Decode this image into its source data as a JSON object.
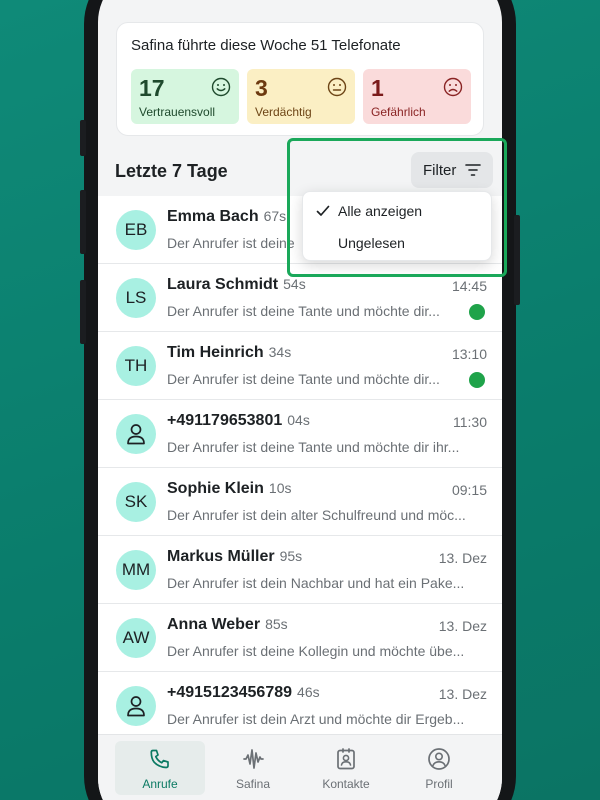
{
  "stats": {
    "title": "Safina führte diese Woche 51 Telefonate",
    "items": [
      {
        "value": "17",
        "label": "Vertrauensvoll",
        "icon": "smile-icon"
      },
      {
        "value": "3",
        "label": "Verdächtig",
        "icon": "neutral-face-icon"
      },
      {
        "value": "1",
        "label": "Gefährlich",
        "icon": "frown-icon"
      }
    ]
  },
  "section_title": "Letzte 7 Tage",
  "filter": {
    "label": "Filter",
    "options": [
      {
        "label": "Alle anzeigen",
        "selected": true
      },
      {
        "label": "Ungelesen",
        "selected": false
      }
    ]
  },
  "calls": [
    {
      "initials": "EB",
      "name": "Emma Bach",
      "duration": "67s",
      "time": "",
      "preview": "Der Anrufer ist deine",
      "unread": false
    },
    {
      "initials": "LS",
      "name": "Laura Schmidt",
      "duration": "54s",
      "time": "14:45",
      "preview": "Der Anrufer ist deine Tante und möchte dir...",
      "unread": true
    },
    {
      "initials": "TH",
      "name": "Tim Heinrich",
      "duration": "34s",
      "time": "13:10",
      "preview": "Der Anrufer ist deine Tante und möchte dir...",
      "unread": true
    },
    {
      "initials": "",
      "name": "+491179653801",
      "duration": "04s",
      "time": "11:30",
      "preview": "Der Anrufer ist deine Tante und möchte dir ihr...",
      "unread": false
    },
    {
      "initials": "SK",
      "name": "Sophie Klein",
      "duration": "10s",
      "time": "09:15",
      "preview": "Der Anrufer ist dein alter Schulfreund und möc...",
      "unread": false
    },
    {
      "initials": "MM",
      "name": "Markus Müller",
      "duration": "95s",
      "time": "13. Dez",
      "preview": "Der Anrufer ist dein Nachbar und hat ein Pake...",
      "unread": false
    },
    {
      "initials": "AW",
      "name": "Anna Weber",
      "duration": "85s",
      "time": "13. Dez",
      "preview": "Der Anrufer ist deine Kollegin und möchte übe...",
      "unread": false
    },
    {
      "initials": "",
      "name": "+4915123456789",
      "duration": "46s",
      "time": "13. Dez",
      "preview": "Der Anrufer ist dein Arzt und möchte dir Ergeb...",
      "unread": false
    }
  ],
  "tabs": [
    {
      "label": "Anrufe",
      "icon": "phone-icon",
      "active": true
    },
    {
      "label": "Safina",
      "icon": "soundwave-icon",
      "active": false
    },
    {
      "label": "Kontakte",
      "icon": "contacts-icon",
      "active": false
    },
    {
      "label": "Profil",
      "icon": "profile-icon",
      "active": false
    }
  ],
  "colors": {
    "background": "#0f8a78",
    "accent": "#0b7a63",
    "avatar": "#a8f0e2",
    "unread_dot": "#1fa34a",
    "highlight": "#1aa85a"
  }
}
